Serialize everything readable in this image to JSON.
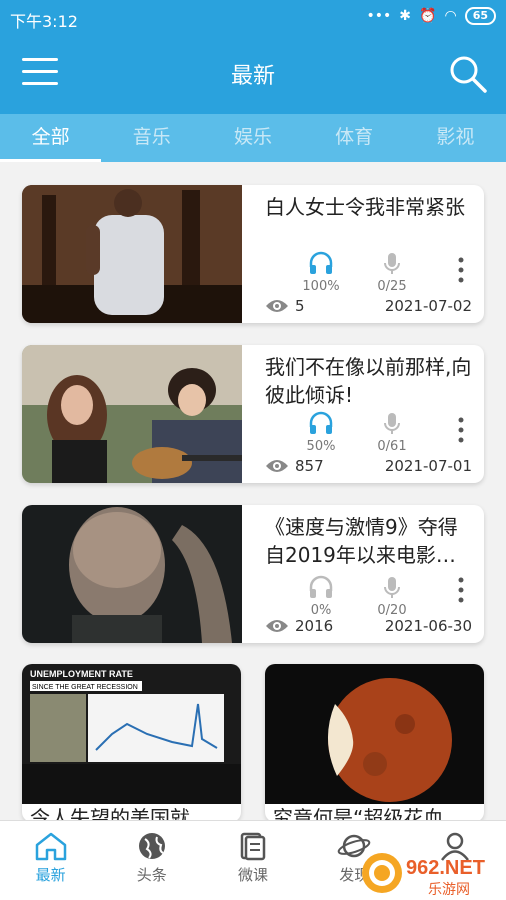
{
  "status_bar": {
    "time": "下午3:12",
    "battery": "65"
  },
  "header": {
    "title": "最新"
  },
  "tabs": [
    {
      "label": "全部",
      "active": true
    },
    {
      "label": "音乐",
      "active": false
    },
    {
      "label": "娱乐",
      "active": false
    },
    {
      "label": "体育",
      "active": false
    },
    {
      "label": "影视",
      "active": false
    }
  ],
  "cards": [
    {
      "title": "白人女士令我非常紧张",
      "listen": "100%",
      "mic": "0/25",
      "views": "5",
      "date": "2021-07-02"
    },
    {
      "title": "我们不在像以前那样,向彼此倾诉!",
      "listen": "50%",
      "mic": "0/61",
      "views": "857",
      "date": "2021-07-01"
    },
    {
      "title": "《速度与激情9》夺得自2019年以来电影…",
      "listen": "0%",
      "mic": "0/20",
      "views": "2016",
      "date": "2021-06-30"
    }
  ],
  "grid": [
    {
      "title": "令人失望的美国就",
      "chart_caption": "UNEMPLOYMENT RATE",
      "chart_subcaption": "SINCE THE GREAT RECESSION"
    },
    {
      "title": "究竟何是“超级花血"
    }
  ],
  "bottom_nav": [
    {
      "label": "最新",
      "active": true
    },
    {
      "label": "头条",
      "active": false
    },
    {
      "label": "微课",
      "active": false
    },
    {
      "label": "发现",
      "active": false
    }
  ],
  "watermark": "962.NET 乐游网",
  "colors": {
    "primary": "#2aa2dd",
    "tab_bar": "#5bbde9",
    "listen_icon": "#2aa2dd",
    "inactive_icon": "#bbbbbb"
  }
}
